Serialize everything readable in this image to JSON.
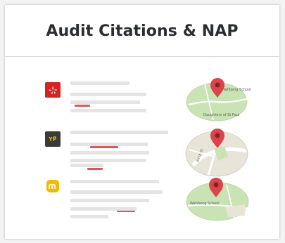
{
  "card": {
    "title": "Audit Citations & NAP"
  },
  "listings": [
    {
      "source_icon": "yelp-icon",
      "brand_color": "#d32323",
      "map_labels": [
        "Wahbeng School",
        "Daughters of St Paul"
      ]
    },
    {
      "source_icon": "yellow-pages-icon",
      "brand_color": "#3a3a3a",
      "map_labels": [
        "Birch St"
      ]
    },
    {
      "source_icon": "merchantcircle-icon",
      "brand_color": "#f5b800",
      "map_labels": [
        "Wahbeng School"
      ]
    }
  ],
  "colors": {
    "pin": "#d9454a",
    "map_green": "#c9e3b5",
    "map_road": "#ffffff",
    "highlight_bar": "#d9585a",
    "placeholder_bar": "#e4e4e4"
  }
}
